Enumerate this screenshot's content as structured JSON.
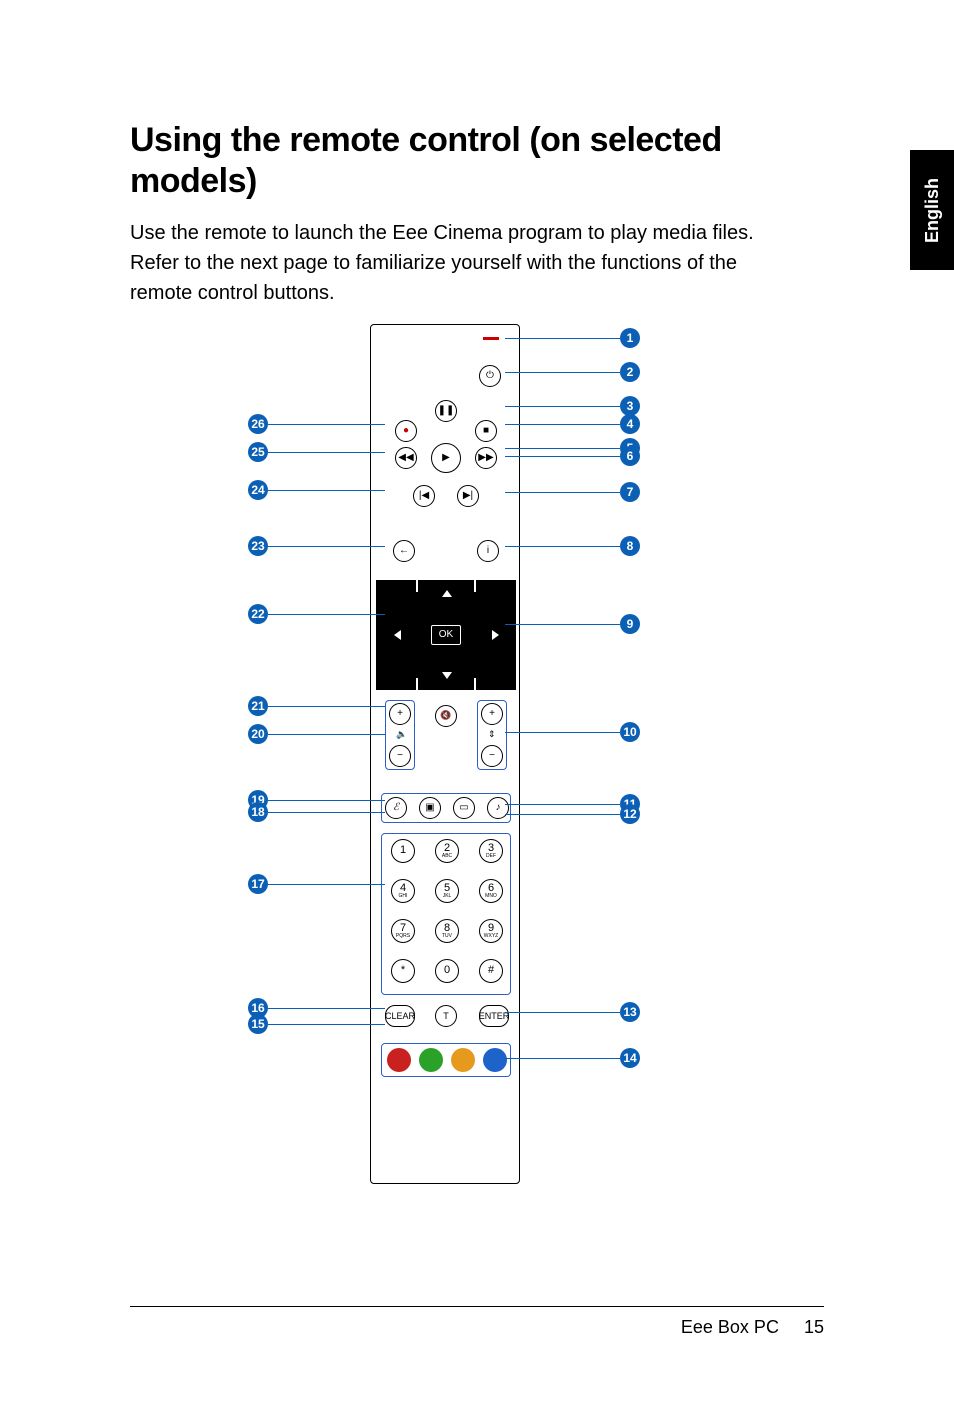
{
  "tab_label": "English",
  "heading": "Using the remote control (on selected models)",
  "intro": "Use the remote to launch the Eee Cinema program to play media files. Refer to the next page to familiarize yourself with the functions of the remote control buttons.",
  "footer_text": "Eee Box PC",
  "page_number": "15",
  "callouts_right": [
    "1",
    "2",
    "3",
    "4",
    "5",
    "6",
    "7",
    "8",
    "9",
    "10",
    "11",
    "12",
    "13",
    "14"
  ],
  "callouts_left": [
    "26",
    "25",
    "24",
    "23",
    "22",
    "21",
    "20",
    "19",
    "18",
    "17",
    "16",
    "15"
  ],
  "remote": {
    "ok_label": "OK",
    "keypad": [
      {
        "n": "1",
        "s": ""
      },
      {
        "n": "2",
        "s": "ABC"
      },
      {
        "n": "3",
        "s": "DEF"
      },
      {
        "n": "4",
        "s": "GHI"
      },
      {
        "n": "5",
        "s": "JKL"
      },
      {
        "n": "6",
        "s": "MNO"
      },
      {
        "n": "7",
        "s": "PQRS"
      },
      {
        "n": "8",
        "s": "TUV"
      },
      {
        "n": "9",
        "s": "WXYZ"
      },
      {
        "n": "*",
        "s": ""
      },
      {
        "n": "0",
        "s": ""
      },
      {
        "n": "#",
        "s": ""
      }
    ],
    "bottom_row": {
      "clear": "CLEAR",
      "enter": "ENTER"
    },
    "colors": [
      "#c92020",
      "#2aa22a",
      "#e59a1e",
      "#1e63c9"
    ],
    "icons": {
      "power": "⏻",
      "pause": "❚❚",
      "stop": "■",
      "rec": "●",
      "play": "▶",
      "rew": "◀◀",
      "ff": "▶▶",
      "prev": "|◀",
      "next": "▶|",
      "back": "←",
      "info": "i",
      "eee": "ℰ",
      "photo": "▣",
      "video": "▭",
      "music": "♪",
      "plus": "+",
      "minus": "−",
      "mute": "🔇",
      "updn": "⇕",
      "vol": "🔈",
      "txt": "T"
    }
  }
}
